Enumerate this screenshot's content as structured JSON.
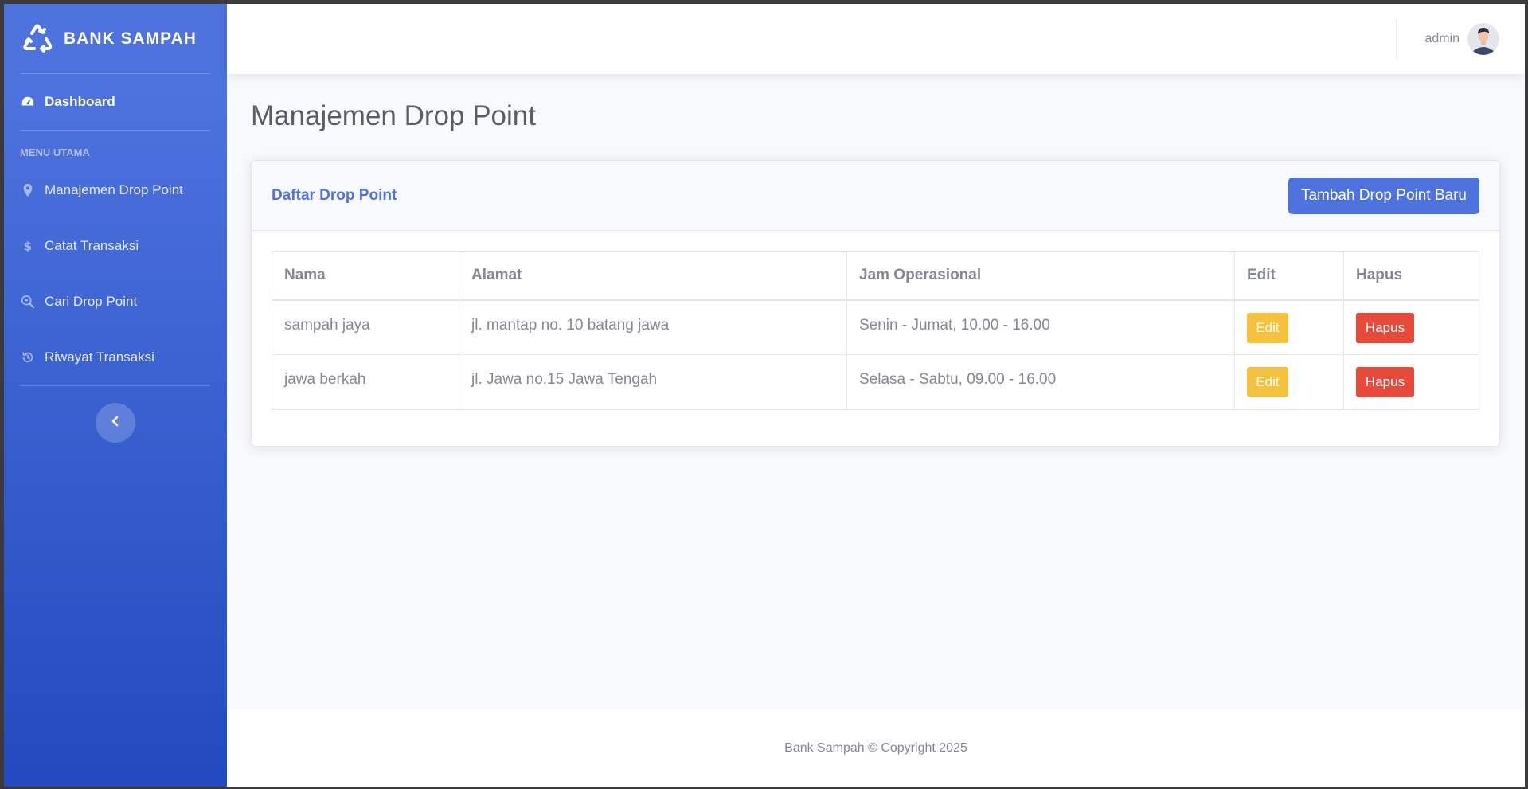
{
  "sidebar": {
    "brand": "BANK SAMPAH",
    "brand_icon": "recycle-icon",
    "dashboard_label": "Dashboard",
    "heading": "MENU UTAMA",
    "items": [
      {
        "label": "Manajemen Drop Point",
        "icon": "map-marker-icon"
      },
      {
        "label": "Catat Transaksi",
        "icon": "dollar-icon"
      },
      {
        "label": "Cari Drop Point",
        "icon": "search-location-icon"
      },
      {
        "label": "Riwayat Transaksi",
        "icon": "history-icon"
      }
    ],
    "toggle_icon": "chevron-left-icon"
  },
  "topbar": {
    "user_name": "admin"
  },
  "page": {
    "title": "Manajemen Drop Point"
  },
  "card": {
    "title": "Daftar Drop Point",
    "add_button": "Tambah Drop Point Baru"
  },
  "table": {
    "headers": [
      "Nama",
      "Alamat",
      "Jam Operasional",
      "Edit",
      "Hapus"
    ],
    "rows": [
      {
        "nama": "sampah jaya",
        "alamat": "jl. mantap no. 10 batang jawa",
        "jam": "Senin - Jumat, 10.00 - 16.00",
        "edit": "Edit",
        "hapus": "Hapus"
      },
      {
        "nama": "jawa berkah",
        "alamat": "jl. Jawa no.15 Jawa Tengah",
        "jam": "Selasa - Sabtu, 09.00 - 16.00",
        "edit": "Edit",
        "hapus": "Hapus"
      }
    ]
  },
  "footer": {
    "text": "Bank Sampah © Copyright 2025"
  },
  "colors": {
    "primary": "#4e73df",
    "warning": "#f6c23e",
    "danger": "#e74a3b",
    "text_muted": "#858796"
  }
}
